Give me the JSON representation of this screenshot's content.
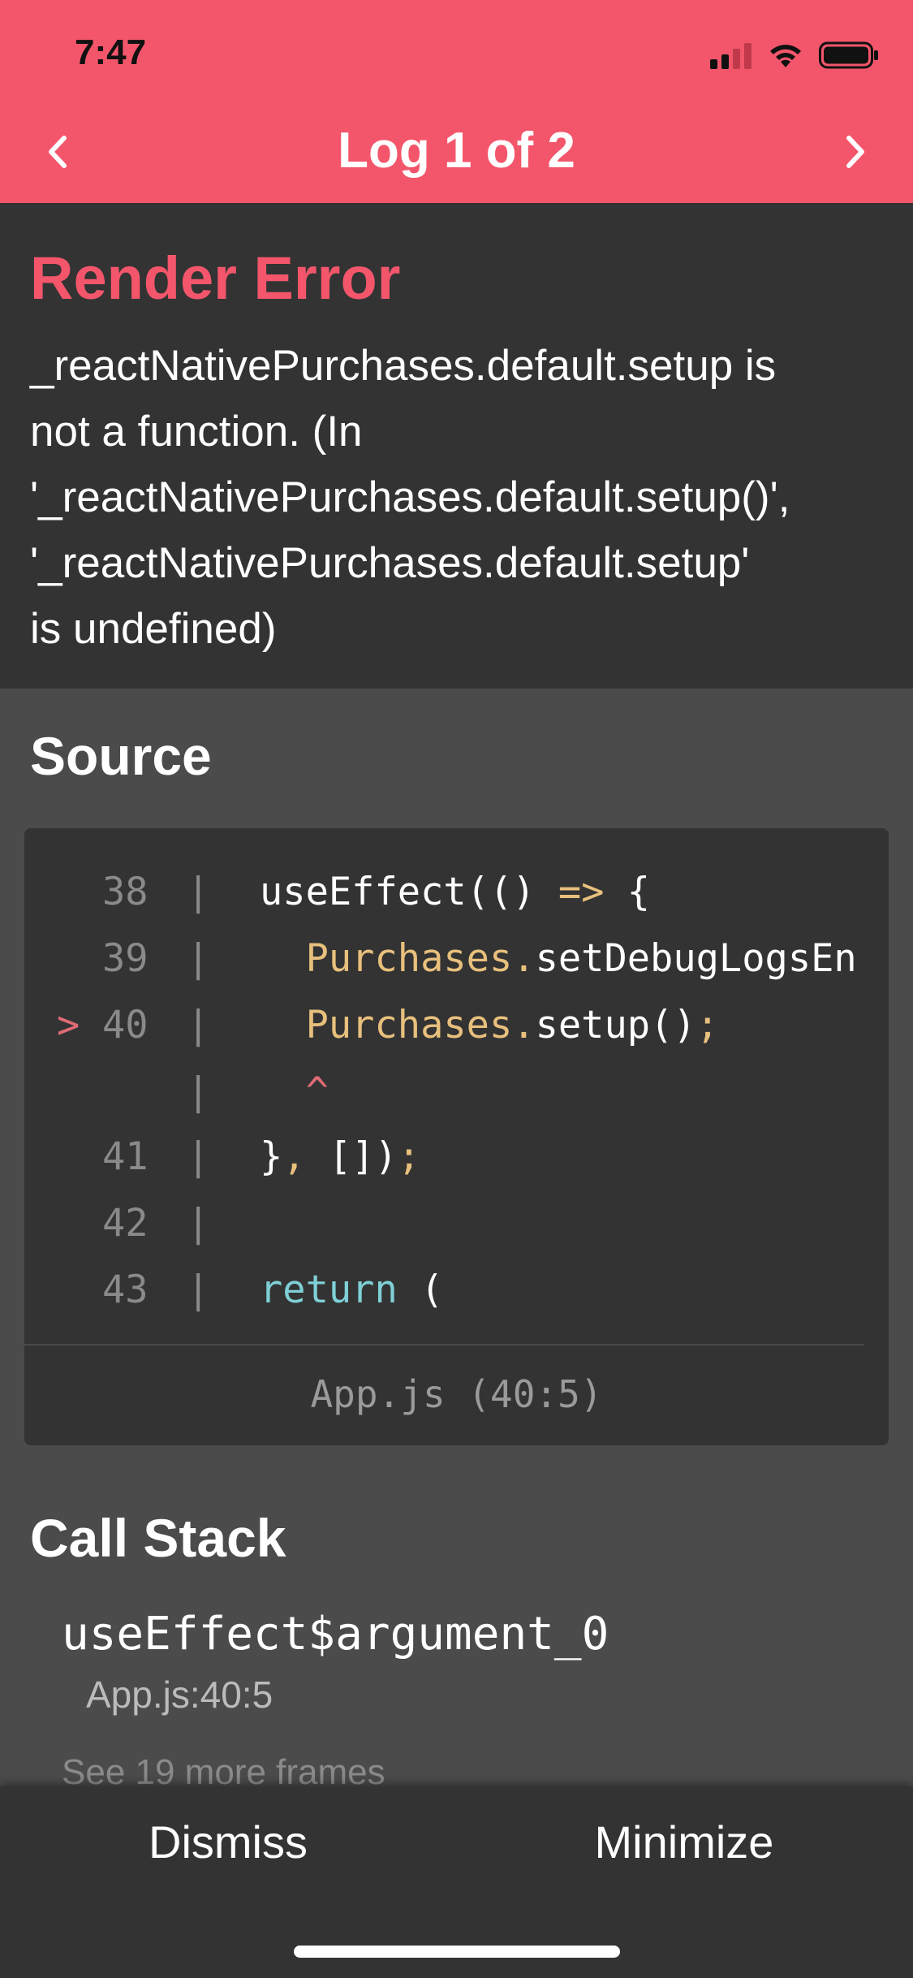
{
  "status_bar": {
    "time": "7:47",
    "icons": [
      "signal-icon",
      "wifi-icon",
      "battery-icon"
    ]
  },
  "nav": {
    "title": "Log 1 of 2",
    "prev_icon": "chevron-left-icon",
    "next_icon": "chevron-right-icon"
  },
  "error": {
    "title": "Render Error",
    "message": "_reactNativePurchases.default.setup is\nnot a function. (In\n'_reactNativePurchases.default.setup()',\n'_reactNativePurchases.default.setup'\nis undefined)"
  },
  "source": {
    "title": "Source",
    "lines": [
      {
        "num": "38",
        "arrow": "",
        "code": "useEffect(() => {"
      },
      {
        "num": "39",
        "arrow": "",
        "code": "  Purchases.setDebugLogsEn"
      },
      {
        "num": "40",
        "arrow": ">",
        "code": "  Purchases.setup();"
      },
      {
        "num": "",
        "arrow": "",
        "code": "  ^"
      },
      {
        "num": "41",
        "arrow": "",
        "code": "}, []);"
      },
      {
        "num": "42",
        "arrow": "",
        "code": ""
      },
      {
        "num": "43",
        "arrow": "",
        "code": "return ("
      }
    ],
    "file": "App.js (40:5)"
  },
  "call_stack": {
    "title": "Call Stack",
    "frame_name": "useEffect$argument_0",
    "frame_location": "App.js:40:5",
    "more_frames": "See 19 more frames"
  },
  "footer": {
    "dismiss_label": "Dismiss",
    "minimize_label": "Minimize"
  },
  "colors": {
    "accent": "#f3566b",
    "panel": "#333333",
    "background": "#4b4b4b"
  }
}
